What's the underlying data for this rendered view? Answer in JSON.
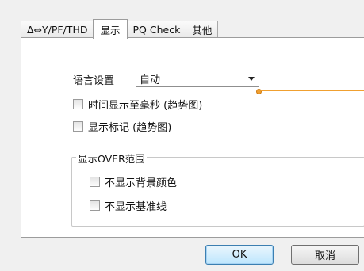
{
  "tabs": [
    {
      "label": "Δ⇔Y/PF/THD"
    },
    {
      "label": "显示",
      "active": true
    },
    {
      "label": "PQ Check"
    },
    {
      "label": "其他"
    }
  ],
  "language": {
    "label": "语言设置",
    "selected": "自动"
  },
  "options": {
    "time_ms": "时间显示至毫秒 (趋势图)",
    "show_marker": "显示标记 (趋势图)"
  },
  "over_group": {
    "title": "显示OVER范围",
    "no_bg_color": "不显示背景颜色",
    "no_baseline": "不显示基准线"
  },
  "buttons": {
    "ok": "OK",
    "cancel": "取消"
  },
  "colors": {
    "callout": "#f0a030",
    "ok_accent": "#3c7fb1"
  }
}
